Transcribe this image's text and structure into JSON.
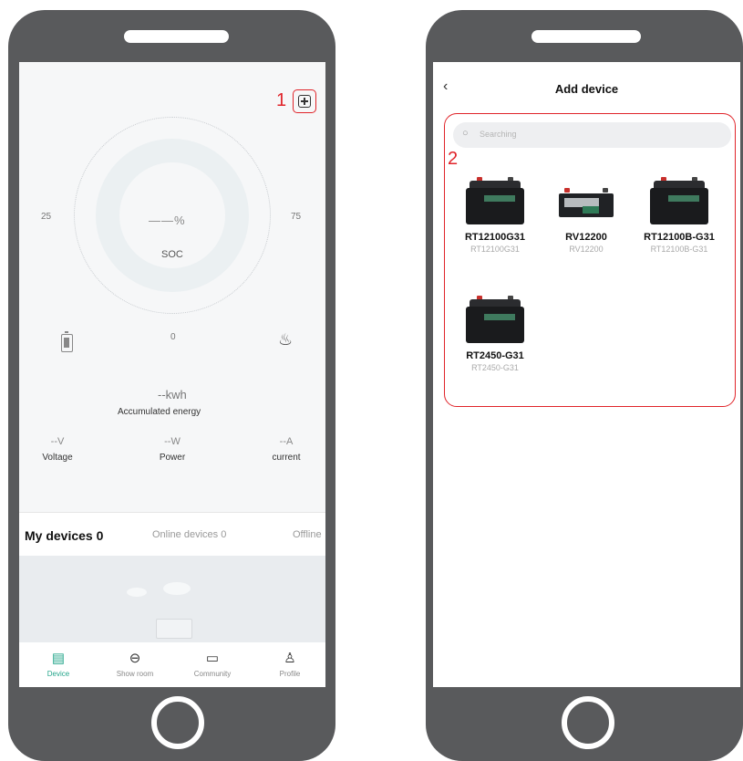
{
  "left_screen": {
    "step_number": "1",
    "gauge": {
      "value": "——%",
      "label": "SOC",
      "scale_left": "25",
      "scale_right": "75",
      "scale_bottom": "0"
    },
    "energy": {
      "value": "--kwh",
      "label": "Accumulated energy"
    },
    "metrics": [
      {
        "value": "--V",
        "label": "Voltage"
      },
      {
        "value": "--W",
        "label": "Power"
      },
      {
        "value": "--A",
        "label": "current"
      }
    ],
    "tabs": {
      "mine": "My devices 0",
      "online": "Online devices 0",
      "offline": "Offline"
    },
    "nav": [
      {
        "label": "Device",
        "icon": "device-list-icon",
        "active": true
      },
      {
        "label": "Show room",
        "icon": "shopping-basket-icon",
        "active": false
      },
      {
        "label": "Community",
        "icon": "chat-bubble-icon",
        "active": false
      },
      {
        "label": "Profile",
        "icon": "person-icon",
        "active": false
      }
    ],
    "accent_color": "#23a58a"
  },
  "right_screen": {
    "title": "Add device",
    "search_placeholder": "Searching",
    "step_number": "2",
    "products": [
      {
        "name": "RT12100G31",
        "model": "RT12100G31",
        "image": "battery-box-image"
      },
      {
        "name": "RV12200",
        "model": "RV12200",
        "image": "battery-flat-image"
      },
      {
        "name": "RT12100B-G31",
        "model": "RT12100B-G31",
        "image": "battery-box-image"
      },
      {
        "name": "RT2450-G31",
        "model": "RT2450-G31",
        "image": "battery-box-image"
      }
    ],
    "highlight_color": "#e0242a"
  }
}
